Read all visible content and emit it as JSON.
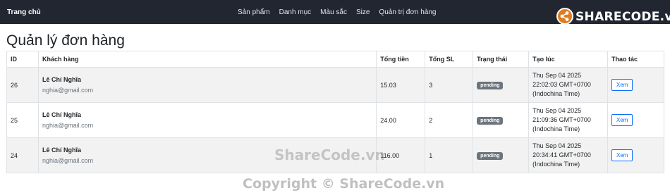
{
  "header": {
    "brand": "Trang chủ",
    "nav": [
      "Sản phẩm",
      "Danh mục",
      "Màu sắc",
      "Size",
      "Quản trị đơn hàng"
    ]
  },
  "logo": {
    "text": "SHARECODE.vn"
  },
  "page": {
    "title": "Quản lý đơn hàng"
  },
  "table": {
    "columns": [
      "ID",
      "Khách hàng",
      "Tổng tiền",
      "Tổng SL",
      "Trạng thái",
      "Tạo lúc",
      "Thao tác"
    ],
    "rows": [
      {
        "id": "26",
        "name": "Lê Chí Nghĩa",
        "email": "nghia@gmail.com",
        "total": "15.03",
        "qty": "3",
        "status": "pending",
        "created": "Thu Sep 04 2025 22:02:03 GMT+0700 (Indochina Time)",
        "action": "Xem"
      },
      {
        "id": "25",
        "name": "Lê Chí Nghĩa",
        "email": "nghia@gmail.com",
        "total": "24.00",
        "qty": "2",
        "status": "pending",
        "created": "Thu Sep 04 2025 21:09:36 GMT+0700 (Indochina Time)",
        "action": "Xem"
      },
      {
        "id": "24",
        "name": "Lê Chí Nghĩa",
        "email": "nghia@gmail.com",
        "total": "116.00",
        "qty": "1",
        "status": "pending",
        "created": "Thu Sep 04 2025 20:34:41 GMT+0700 (Indochina Time)",
        "action": "Xem"
      }
    ]
  },
  "watermark": {
    "center": "ShareCode.vn",
    "footer": "Copyright © ShareCode.vn"
  },
  "colors": {
    "navbar": "#212631",
    "badge": "#6c757d",
    "button": "#0d6efd",
    "stripe": "#f2f2f2"
  }
}
